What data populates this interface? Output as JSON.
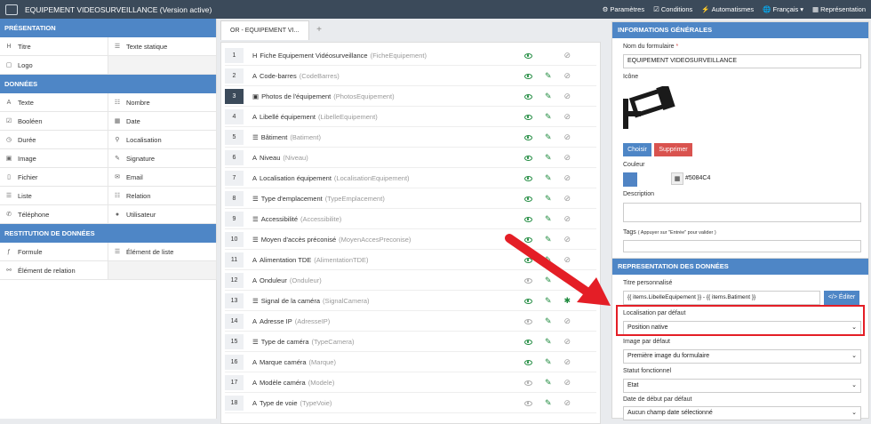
{
  "topbar": {
    "title": "EQUIPEMENT VIDEOSURVEILLANCE (Version active)",
    "menu": [
      "Paramètres",
      "Conditions",
      "Automatismes",
      "Français",
      "Représentation"
    ]
  },
  "left": {
    "sections": [
      {
        "title": "PRÉSENTATION",
        "items": [
          {
            "icon": "title-icon",
            "label": "Titre"
          },
          {
            "icon": "static-text-icon",
            "label": "Texte statique"
          },
          {
            "icon": "logo-icon",
            "label": "Logo"
          }
        ]
      },
      {
        "title": "DONNÉES",
        "items": [
          {
            "icon": "text-icon",
            "label": "Texte"
          },
          {
            "icon": "number-icon",
            "label": "Nombre"
          },
          {
            "icon": "boolean-icon",
            "label": "Booléen"
          },
          {
            "icon": "date-icon",
            "label": "Date"
          },
          {
            "icon": "duration-icon",
            "label": "Durée"
          },
          {
            "icon": "location-icon",
            "label": "Localisation"
          },
          {
            "icon": "image-icon",
            "label": "Image"
          },
          {
            "icon": "signature-icon",
            "label": "Signature"
          },
          {
            "icon": "file-icon",
            "label": "Fichier"
          },
          {
            "icon": "email-icon",
            "label": "Email"
          },
          {
            "icon": "list-icon",
            "label": "Liste"
          },
          {
            "icon": "relation-icon",
            "label": "Relation"
          },
          {
            "icon": "phone-icon",
            "label": "Téléphone"
          },
          {
            "icon": "user-icon",
            "label": "Utilisateur"
          }
        ]
      },
      {
        "title": "RESTITUTION DE DONNÉES",
        "items": [
          {
            "icon": "formula-icon",
            "label": "Formule"
          },
          {
            "icon": "list-element-icon",
            "label": "Élément de liste"
          },
          {
            "icon": "relation-element-icon",
            "label": "Élément de relation"
          }
        ]
      }
    ]
  },
  "tab": {
    "label": "OR - EQUIPEMENT VI...",
    "plus": "+"
  },
  "rows": [
    {
      "n": "1",
      "glyph": "H",
      "label": "Fiche Equipement Vidéosurveillance",
      "key": "(FicheEquipement)",
      "eye": true,
      "edit": false,
      "loc": "off"
    },
    {
      "n": "2",
      "glyph": "A",
      "label": "Code-barres",
      "key": "(CodeBarres)",
      "eye": true,
      "edit": true,
      "loc": "off"
    },
    {
      "n": "3",
      "glyph": "▣",
      "label": "Photos de l'équipement",
      "key": "(PhotosEquipement)",
      "eye": true,
      "edit": true,
      "loc": "off",
      "sel": true
    },
    {
      "n": "4",
      "glyph": "A",
      "label": "Libellé équipement",
      "key": "(LibelleEquipement)",
      "eye": true,
      "edit": true,
      "loc": "off"
    },
    {
      "n": "5",
      "glyph": "☰",
      "label": "Bâtiment",
      "key": "(Batiment)",
      "eye": true,
      "edit": true,
      "loc": "off"
    },
    {
      "n": "6",
      "glyph": "A",
      "label": "Niveau",
      "key": "(Niveau)",
      "eye": true,
      "edit": true,
      "loc": "off"
    },
    {
      "n": "7",
      "glyph": "A",
      "label": "Localisation équipement",
      "key": "(LocalisationEquipement)",
      "eye": true,
      "edit": true,
      "loc": "off"
    },
    {
      "n": "8",
      "glyph": "☰",
      "label": "Type d'emplacement",
      "key": "(TypeEmplacement)",
      "eye": true,
      "edit": true,
      "loc": "off"
    },
    {
      "n": "9",
      "glyph": "☰",
      "label": "Accessibilité",
      "key": "(Accessibilite)",
      "eye": true,
      "edit": true,
      "loc": "off"
    },
    {
      "n": "10",
      "glyph": "☰",
      "label": "Moyen d'accès préconisé",
      "key": "(MoyenAccesPreconise)",
      "eye": true,
      "edit": true,
      "loc": "off"
    },
    {
      "n": "11",
      "glyph": "A",
      "label": "Alimentation TDE",
      "key": "(AlimentationTDE)",
      "eye": true,
      "edit": true,
      "loc": "off"
    },
    {
      "n": "12",
      "glyph": "A",
      "label": "Onduleur",
      "key": "(Onduleur)",
      "eye": false,
      "edit": true,
      "loc": "off"
    },
    {
      "n": "13",
      "glyph": "☰",
      "label": "Signal de la caméra",
      "key": "(SignalCamera)",
      "eye": true,
      "edit": true,
      "loc": "on"
    },
    {
      "n": "14",
      "glyph": "A",
      "label": "Adresse IP",
      "key": "(AdresseIP)",
      "eye": false,
      "edit": true,
      "loc": "off"
    },
    {
      "n": "15",
      "glyph": "☰",
      "label": "Type de caméra",
      "key": "(TypeCamera)",
      "eye": true,
      "edit": true,
      "loc": "off"
    },
    {
      "n": "16",
      "glyph": "A",
      "label": "Marque caméra",
      "key": "(Marque)",
      "eye": true,
      "edit": true,
      "loc": "off"
    },
    {
      "n": "17",
      "glyph": "A",
      "label": "Modèle caméra",
      "key": "(Modele)",
      "eye": false,
      "edit": true,
      "loc": "off"
    },
    {
      "n": "18",
      "glyph": "A",
      "label": "Type de voie",
      "key": "(TypeVoie)",
      "eye": false,
      "edit": true,
      "loc": "off"
    }
  ],
  "info": {
    "title": "INFORMATIONS GÉNÉRALES",
    "name_label": "Nom du formulaire",
    "required_mark": "*",
    "name_value": "EQUIPEMENT VIDEOSURVEILLANCE",
    "icon_label": "Icône",
    "choose": "Choisir",
    "delete": "Supprimer",
    "color_label": "Couleur",
    "color_value": "#5084C4",
    "color": "#5084C4",
    "desc_label": "Description",
    "tags_label": "Tags",
    "tags_hint": "( Appuyer sur \"Entrée\" pour valider )"
  },
  "repr": {
    "title": "REPRESENTATION DES DONNÉES",
    "custom_title_label": "Titre personnalisé",
    "custom_title_value": "{{ items.LibelleEquipement }} - {{ items.Batiment }}",
    "edit_btn": "</> Éditer",
    "loc_label": "Localisation par défaut",
    "loc_value": "Position native",
    "image_label": "Image par défaut",
    "image_value": "Première image du formulaire",
    "status_label": "Statut fonctionnel",
    "status_value": "Etat",
    "date_label": "Date de début par défaut",
    "date_value": "Aucun champ date sélectionné"
  },
  "colors": {
    "accent": "#4E86C6",
    "topbar": "#3B4A5A",
    "danger": "#D9534F",
    "highlight": "#E41E26"
  }
}
